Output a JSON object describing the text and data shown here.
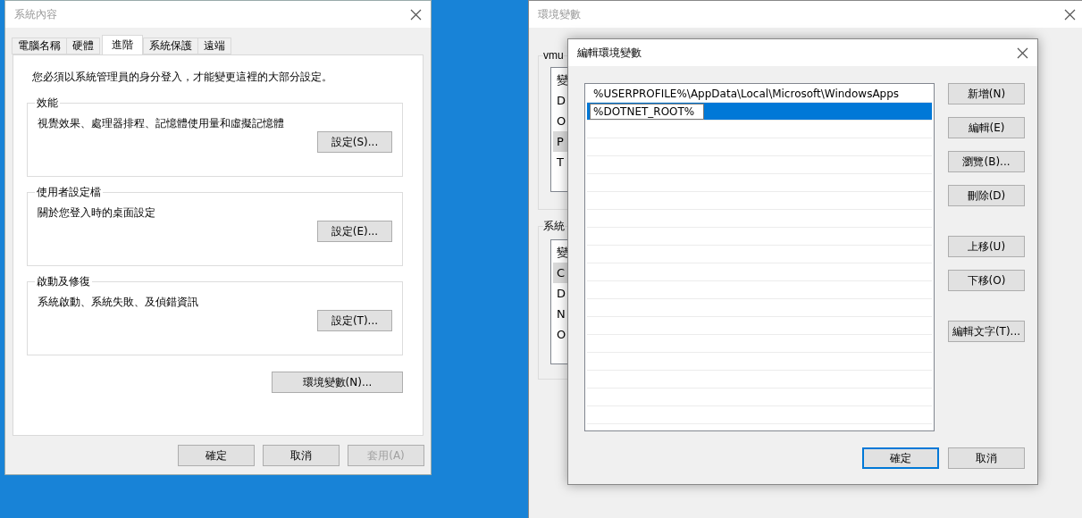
{
  "system_properties": {
    "title": "系統內容",
    "tabs": [
      {
        "label": "電腦名稱",
        "selected": false
      },
      {
        "label": "硬體",
        "selected": false
      },
      {
        "label": "進階",
        "selected": true
      },
      {
        "label": "系統保護",
        "selected": false
      },
      {
        "label": "遠端",
        "selected": false
      }
    ],
    "notice": "您必須以系統管理員的身分登入，才能變更這裡的大部分設定。",
    "groups": [
      {
        "title": "效能",
        "description": "視覺效果、處理器排程、記憶體使用量和虛擬記憶體",
        "button": "設定(S)..."
      },
      {
        "title": "使用者設定檔",
        "description": "關於您登入時的桌面設定",
        "button": "設定(E)..."
      },
      {
        "title": "啟動及修復",
        "description": "系統啟動、系統失敗、及偵錯資訊",
        "button": "設定(T)..."
      }
    ],
    "env_button": "環境變數(N)...",
    "buttons": [
      {
        "label": "確定",
        "disabled": false
      },
      {
        "label": "取消",
        "disabled": false
      },
      {
        "label": "套用(A)",
        "disabled": true
      }
    ]
  },
  "environment_variables": {
    "title": "環境變數",
    "groups": [
      {
        "title": "vmu",
        "header": "變",
        "rows": [
          {
            "text": "D",
            "selected": false
          },
          {
            "text": "O",
            "selected": false
          },
          {
            "text": "P",
            "selected": true
          },
          {
            "text": "T",
            "selected": false
          }
        ]
      },
      {
        "title": "系統",
        "header": "變",
        "rows": [
          {
            "text": "C",
            "selected": true
          },
          {
            "text": "D",
            "selected": false
          },
          {
            "text": "N",
            "selected": false
          },
          {
            "text": "O",
            "selected": false
          }
        ]
      }
    ]
  },
  "edit_dialog": {
    "title": "編輯環境變數",
    "entries": [
      {
        "value": "%USERPROFILE%\\AppData\\Local\\Microsoft\\WindowsApps",
        "selected": false,
        "editing": false
      },
      {
        "value": "%DOTNET_ROOT%",
        "selected": true,
        "editing": true
      }
    ],
    "side_button_groups": [
      [
        "新增(N)",
        "編輯(E)",
        "瀏覽(B)...",
        "刪除(D)"
      ],
      [
        "上移(U)",
        "下移(O)"
      ],
      [
        "編輯文字(T)..."
      ]
    ],
    "buttons": [
      {
        "label": "確定",
        "default": true
      },
      {
        "label": "取消",
        "default": false
      }
    ]
  }
}
